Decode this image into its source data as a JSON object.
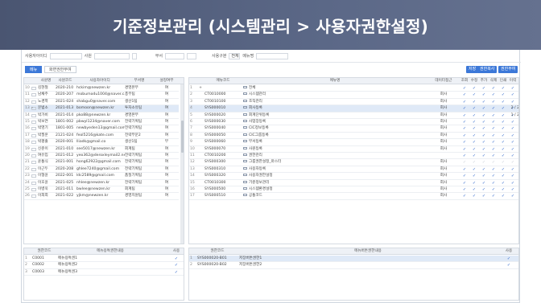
{
  "banner": {
    "title": "기준정보관리 (시스템관리 > 사용자권한설정)"
  },
  "search": {
    "user_id_label": "사용자아이디",
    "user_id_value": "",
    "user_name_label": "사원",
    "user_name_value": "",
    "dept_label": "부서",
    "dept_value": "",
    "role_label": "사용구분",
    "role_value": "전체",
    "menu_label": "메뉴명",
    "menu_value": ""
  },
  "toolbar": {
    "tab_menu": "메뉴",
    "tab_role": "화면권한부여",
    "btn_save": "저장",
    "btn_copy": "권한복사",
    "btn_grant": "권한부여"
  },
  "users": {
    "headers": [
      "",
      "",
      "사원명",
      "사원코드",
      "사용자아이디",
      "부서명",
      "설정여부"
    ],
    "rows": [
      {
        "no": "10",
        "name": "김현철",
        "code": "2020-210",
        "id": "hckim@newzen.kr",
        "dept": "경영본부",
        "set": "여",
        "sel": false
      },
      {
        "no": "11",
        "name": "남채주",
        "code": "2020-207",
        "id": "mobumodu1004@naver.c..",
        "dept": "총무팀",
        "set": "여",
        "sel": false
      },
      {
        "no": "12",
        "name": "노경학",
        "code": "2021-024",
        "id": "shabgu0@naver.com",
        "dept": "생산1팀",
        "set": "여",
        "sel": false
      },
      {
        "no": "13",
        "name": "문범소",
        "code": "2021-013",
        "id": "bomoon@newzen.kr",
        "dept": "투자소유팀",
        "set": "여",
        "sel": true
      },
      {
        "no": "14",
        "name": "박가비",
        "code": "2021-014",
        "id": "pko88@newzen.kr",
        "dept": "경영본부",
        "set": "여",
        "sel": false
      },
      {
        "no": "15",
        "name": "박보연",
        "code": "1801-002",
        "id": "pbwyl1234@naver.com",
        "dept": "전략기획팀",
        "set": "여",
        "sel": false
      },
      {
        "no": "16",
        "name": "박영기",
        "code": "1801-005",
        "id": "newbyeden13@gmail.com",
        "dept": "전략기획팀",
        "set": "여",
        "sel": false
      },
      {
        "no": "17",
        "name": "박필훈",
        "code": "2121-024",
        "id": "feol5216@kate.com",
        "dept": "전략부문2",
        "set": "여",
        "sel": false
      },
      {
        "no": "18",
        "name": "박평출",
        "code": "2020-001",
        "id": "lliadk@gmail.co",
        "dept": "생산1팀",
        "set": "부",
        "sel": false
      },
      {
        "no": "19",
        "name": "신준이",
        "code": "2021-010",
        "id": "see5017@newzen.kr",
        "dept": "회계팀",
        "set": "여",
        "sel": false
      },
      {
        "no": "20",
        "name": "여유입",
        "code": "2021-012",
        "id": "yeo362@deroxleymail2.ne..",
        "dept": "전략기획팀",
        "set": "여",
        "sel": false
      },
      {
        "no": "21",
        "name": "윤통식",
        "code": "2021-001",
        "id": "hong62922@gmail.com",
        "dept": "전략기획팀",
        "set": "여",
        "sel": false
      },
      {
        "no": "22",
        "name": "이근두",
        "code": "2020-208",
        "id": "ghlee7240@gmail.com",
        "dept": "전략기획팀",
        "set": "여",
        "sel": false
      },
      {
        "no": "23",
        "name": "이형윤",
        "code": "2022-001",
        "id": "ldc2589@gmail.com",
        "dept": "품질기획팀",
        "set": "여",
        "sel": false
      },
      {
        "no": "24",
        "name": "이호윤",
        "code": "2021-025",
        "id": "nhlee@newzen.kr",
        "dept": "전략기획팀",
        "set": "여",
        "sel": false
      },
      {
        "no": "25",
        "name": "이병욱",
        "code": "2021-011",
        "id": "bwlee@newzen.kr",
        "dept": "회계팀",
        "set": "여",
        "sel": false
      },
      {
        "no": "26",
        "name": "이희희",
        "code": "2021-022",
        "id": "yjkm@newzen.kr",
        "dept": "경영지원팀",
        "set": "여",
        "sel": false
      }
    ]
  },
  "menus": {
    "headers": [
      "",
      "",
      "메뉴코드",
      "메뉴명",
      "데이터접근",
      "조회",
      "수정",
      "추가",
      "삭제",
      "인쇄",
      "이력"
    ],
    "rows": [
      {
        "no": "1",
        "mark": "+",
        "code": "",
        "name": "전체",
        "access": "",
        "c": [
          1,
          1,
          1,
          1,
          1,
          1
        ],
        "hist": "",
        "sel": false
      },
      {
        "no": "2",
        "mark": "",
        "code": "CT0010000",
        "name": "시스템관리",
        "access": "회사",
        "c": [
          1,
          1,
          1,
          1,
          1,
          1
        ],
        "hist": "",
        "sel": false
      },
      {
        "no": "3",
        "mark": "",
        "code": "CT0010100",
        "name": "조직관리",
        "access": "회사",
        "c": [
          1,
          1,
          1,
          1,
          1,
          1
        ],
        "hist": "",
        "sel": false
      },
      {
        "no": "4",
        "mark": "",
        "code": "SYS000010",
        "name": "회사등록",
        "access": "회사",
        "c": [
          1,
          1,
          1,
          1,
          1,
          1
        ],
        "hist": "2 / 2",
        "sel": true
      },
      {
        "no": "5",
        "mark": "",
        "code": "SYS000020",
        "name": "회계단위등록",
        "access": "회사",
        "c": [
          1,
          1,
          1,
          1,
          1,
          1
        ],
        "hist": "1 / 2",
        "sel": false
      },
      {
        "no": "6",
        "mark": "",
        "code": "SYS000030",
        "name": "사업장등록",
        "access": "회사",
        "c": [
          1,
          1,
          1,
          1,
          1,
          1
        ],
        "hist": "",
        "sel": false
      },
      {
        "no": "7",
        "mark": "",
        "code": "SYS000040",
        "name": "CIC정보등록",
        "access": "회사",
        "c": [
          1,
          1,
          1,
          1,
          1,
          1
        ],
        "hist": "",
        "sel": false
      },
      {
        "no": "8",
        "mark": "",
        "code": "SYS000050",
        "name": "CIC그룹등록",
        "access": "회사",
        "c": [
          1,
          1,
          1,
          1,
          1,
          1
        ],
        "hist": "",
        "sel": false
      },
      {
        "no": "9",
        "mark": "",
        "code": "SYS000060",
        "name": "부서등록",
        "access": "회사",
        "c": [
          1,
          1,
          1,
          1,
          1,
          1
        ],
        "hist": "",
        "sel": false
      },
      {
        "no": "10",
        "mark": "",
        "code": "SYS000070",
        "name": "사원등록",
        "access": "회사",
        "c": [
          1,
          1,
          1,
          1,
          1,
          1
        ],
        "hist": "",
        "sel": false
      },
      {
        "no": "11",
        "mark": "",
        "code": "CT0010200",
        "name": "권한관리",
        "access": "",
        "c": [
          1,
          1,
          1,
          1,
          1,
          1
        ],
        "hist": "",
        "sel": false
      },
      {
        "no": "12",
        "mark": "",
        "code": "SYS000300",
        "name": "그룹권한설정_마스터",
        "access": "회사",
        "c": [
          0,
          0,
          0,
          0,
          0,
          0
        ],
        "hist": "",
        "sel": false
      },
      {
        "no": "13",
        "mark": "",
        "code": "SYS000310",
        "name": "사용자등록",
        "access": "회사",
        "c": [
          1,
          1,
          1,
          1,
          1,
          1
        ],
        "hist": "",
        "sel": false
      },
      {
        "no": "14",
        "mark": "",
        "code": "SYS000320",
        "name": "사용자권한설정",
        "access": "회사",
        "c": [
          1,
          1,
          1,
          1,
          1,
          1
        ],
        "hist": "",
        "sel": false
      },
      {
        "no": "15",
        "mark": "",
        "code": "CT0010300",
        "name": "기준정보관리",
        "access": "회사",
        "c": [
          1,
          1,
          1,
          1,
          1,
          1
        ],
        "hist": "",
        "sel": false
      },
      {
        "no": "16",
        "mark": "",
        "code": "SYS000500",
        "name": "시스템환경설정",
        "access": "회사",
        "c": [
          1,
          1,
          1,
          1,
          1,
          1
        ],
        "hist": "",
        "sel": false
      },
      {
        "no": "17",
        "mark": "",
        "code": "SYS000510",
        "name": "공통코드",
        "access": "회사",
        "c": [
          1,
          1,
          1,
          1,
          1,
          1
        ],
        "hist": "",
        "sel": false
      }
    ]
  },
  "special": {
    "headers": [
      "권한코드",
      "메뉴용특권한내용",
      "사용"
    ],
    "rows": [
      {
        "no": "1",
        "code": "C0001",
        "name": "메뉴용특권1",
        "use": true,
        "sel": false
      },
      {
        "no": "2",
        "code": "C0002",
        "name": "메뉴용특권2",
        "use": true,
        "sel": false
      },
      {
        "no": "3",
        "code": "C0003",
        "name": "메뉴용특권3",
        "use": true,
        "sel": false
      }
    ]
  },
  "buttons": {
    "headers": [
      "권한코드",
      "메뉴버튼권한내용",
      "사용"
    ],
    "rows": [
      {
        "no": "1",
        "code": "SYS000020-B01",
        "name": "저장버튼권한1",
        "use": true,
        "sel": true
      },
      {
        "no": "2",
        "code": "SYS000020-B02",
        "name": "저장버튼권한2",
        "use": true,
        "sel": false
      }
    ]
  },
  "colors": {
    "accent": "#3c78d8",
    "banner": "#56627f",
    "selected_row": "#dfe9f7"
  }
}
